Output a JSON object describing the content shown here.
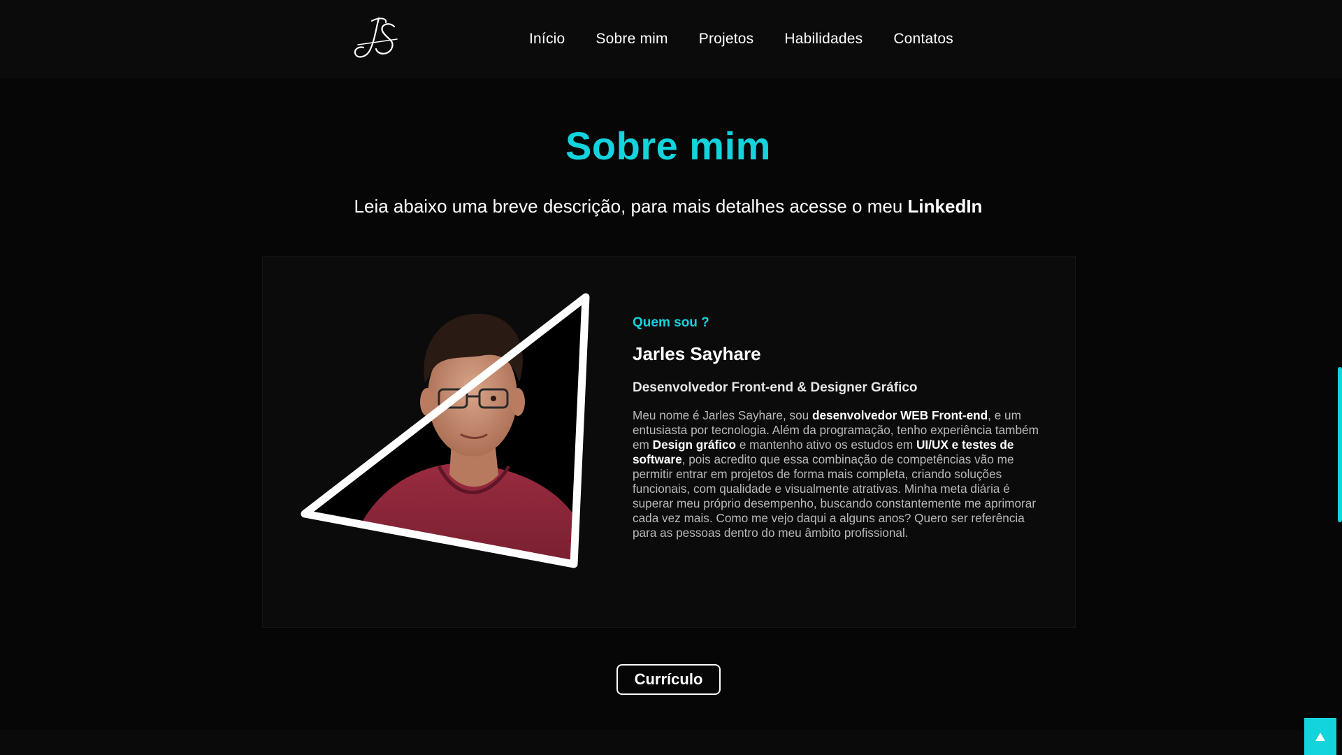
{
  "navbar": {
    "logo_text": "JS",
    "links": [
      {
        "label": "Início"
      },
      {
        "label": "Sobre mim"
      },
      {
        "label": "Projetos"
      },
      {
        "label": "Habilidades"
      },
      {
        "label": "Contatos"
      }
    ]
  },
  "section": {
    "title": "Sobre mim",
    "subtitle_text": "Leia abaixo uma breve descrição, para mais detalhes acesse o meu ",
    "subtitle_link": "LinkedIn"
  },
  "about": {
    "eyebrow": "Quem sou ?",
    "name": "Jarles Sayhare",
    "role": "Desenvolvedor Front-end & Designer Gráfico",
    "bio": [
      {
        "text": "Meu nome é Jarles Sayhare, sou "
      },
      {
        "strong": "desenvolvedor WEB Front-end"
      },
      {
        "text": ", e um entusiasta por tecnologia. Além da programação, tenho experiência também em "
      },
      {
        "strong": "Design gráfico"
      },
      {
        "text": " e mantenho ativo os estudos em "
      },
      {
        "strong": "UI/UX e testes de software"
      },
      {
        "text": ", pois acredito que essa combinação de competências vão me permitir entrar em projetos de forma mais completa, criando soluções funcionais, com qualidade e visualmente atrativas. Minha meta diária é superar meu próprio desempenho, buscando constantemente me aprimorar cada vez mais. Como me vejo daqui a alguns anos? Quero ser referência para as pessoas dentro do meu âmbito profissional."
      }
    ]
  },
  "cv_button": {
    "label": "Currículo"
  },
  "back_to_top": {
    "icon": "arrow-up-icon",
    "glyph": "▲"
  },
  "colors": {
    "accent": "#13d3dd",
    "background": "#060606",
    "card": "#0b0b0b",
    "shirt": "#8e2638"
  }
}
